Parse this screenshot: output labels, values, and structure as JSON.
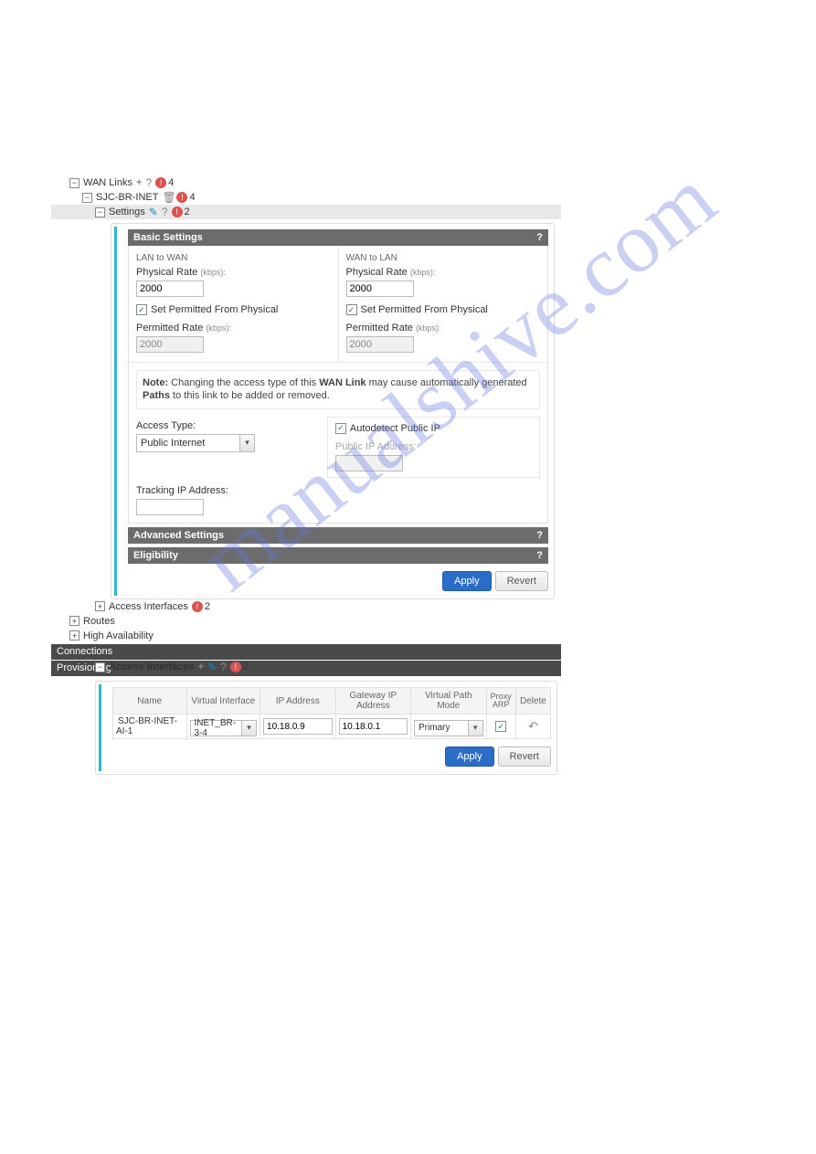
{
  "tree": {
    "wan_links": {
      "label": "WAN Links",
      "errors": 4
    },
    "sjc": {
      "label": "SJC-BR-INET",
      "errors": 4
    },
    "settings": {
      "label": "Settings",
      "errors": 2
    },
    "access_interfaces": {
      "label": "Access Interfaces",
      "errors": 2
    },
    "routes": {
      "label": "Routes"
    },
    "ha": {
      "label": "High Availability"
    }
  },
  "basic": {
    "header": "Basic Settings",
    "lan_to_wan": {
      "title": "LAN to WAN",
      "physical_rate_label": "Physical Rate",
      "units": "(kbps):",
      "physical_rate": "2000",
      "set_permitted_label": "Set Permitted From Physical",
      "permitted_rate_label": "Permitted Rate",
      "permitted_rate": "2000"
    },
    "wan_to_lan": {
      "title": "WAN to LAN",
      "physical_rate_label": "Physical Rate",
      "units": "(kbps):",
      "physical_rate": "2000",
      "set_permitted_label": "Set Permitted From Physical",
      "permitted_rate_label": "Permitted Rate",
      "permitted_rate": "2000"
    },
    "note": {
      "prefix": "Note:",
      "a": "Changing the access type of this",
      "wan_link": "WAN Link",
      "b": "may cause automatically generated",
      "paths": "Paths",
      "c": "to this link to be added or removed."
    },
    "access_type_label": "Access Type:",
    "access_type_value": "Public Internet",
    "autodetect_label": "Autodetect Public IP",
    "public_ip_label": "Public IP Address:",
    "tracking_label": "Tracking IP Address:"
  },
  "sections": {
    "advanced": "Advanced Settings",
    "eligibility": "Eligibility"
  },
  "buttons": {
    "apply": "Apply",
    "revert": "Revert"
  },
  "bars": {
    "connections": "Connections",
    "provisioning": "Provisioning"
  },
  "ai": {
    "header": "Access Interfaces",
    "errors": 2,
    "cols": {
      "name": "Name",
      "vint": "Virtual Interface",
      "ip": "IP Address",
      "gw": "Gateway IP Address",
      "vpm": "Virtual Path Mode",
      "proxy": "Proxy ARP",
      "del": "Delete"
    },
    "row": {
      "name": "SJC-BR-INET-AI-1",
      "vint": "INET_BR-3-4",
      "ip": "10.18.0.9",
      "gw": "10.18.0.1",
      "vpm": "Primary"
    }
  },
  "watermark": "manualshive.com"
}
